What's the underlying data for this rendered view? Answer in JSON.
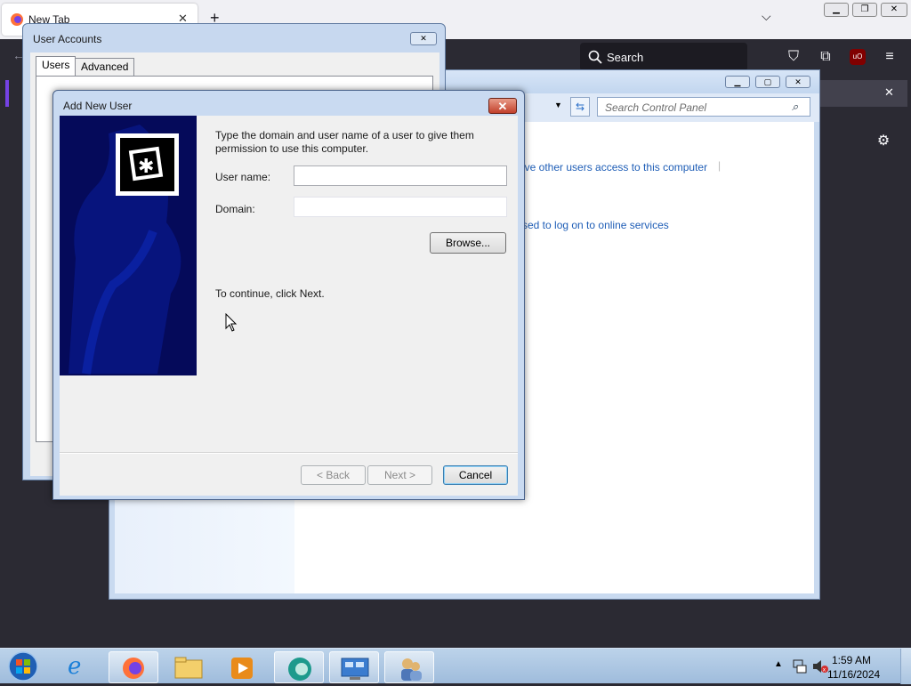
{
  "firefox": {
    "tab_title": "New Tab",
    "new_tab": "+",
    "search_placeholder": "Search"
  },
  "control_panel": {
    "search_placeholder": "Search Control Panel",
    "link1": "ive other users access to this computer",
    "link2": "sed to log on to online services"
  },
  "user_accounts": {
    "title": "User Accounts",
    "tabs": [
      "Users",
      "Advanced"
    ]
  },
  "add_new_user": {
    "title": "Add New User",
    "instruction": "Type the domain and user name of a user to give them permission to use this computer.",
    "user_name_label": "User name:",
    "user_name_value": "",
    "domain_label": "Domain:",
    "domain_value": "",
    "browse_button": "Browse...",
    "continue_text": "To continue, click Next.",
    "back_button": "< Back",
    "next_button": "Next >",
    "cancel_button": "Cancel",
    "close_glyph": "✕"
  },
  "taskbar": {
    "time": "1:59 AM",
    "date": "11/16/2024"
  },
  "colors": {
    "banner": "#050a5a",
    "link": "#1e5db6",
    "taskbar": "#b5cde6"
  }
}
